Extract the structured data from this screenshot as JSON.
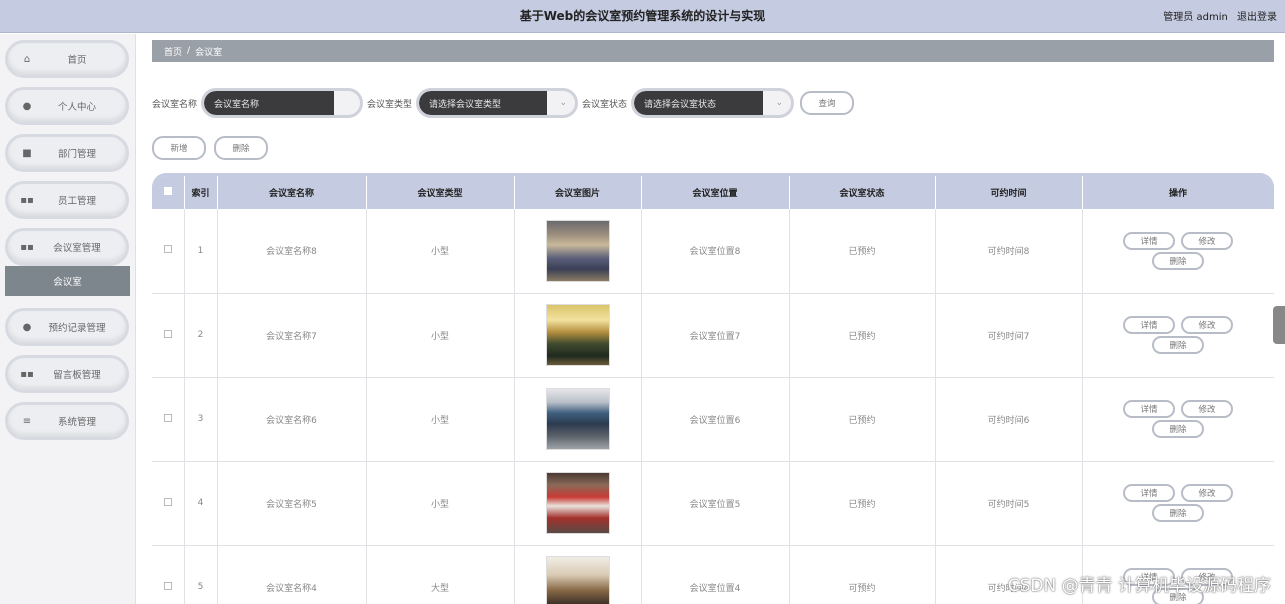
{
  "header": {
    "title": "基于Web的会议室预约管理系统的设计与实现",
    "role": "管理员 admin",
    "logout": "退出登录"
  },
  "sidebar": {
    "items": [
      {
        "label": "首页",
        "icon": "home-icon",
        "glyph": "⌂"
      },
      {
        "label": "个人中心",
        "icon": "user-icon",
        "glyph": "●"
      },
      {
        "label": "部门管理",
        "icon": "department-icon",
        "glyph": "■"
      },
      {
        "label": "员工管理",
        "icon": "grid-icon",
        "glyph": "▪▪"
      },
      {
        "label": "会议室管理",
        "icon": "grid-icon",
        "glyph": "▪▪"
      },
      {
        "label": "预约记录管理",
        "icon": "person-icon",
        "glyph": "●"
      },
      {
        "label": "留言板管理",
        "icon": "grid-icon",
        "glyph": "▪▪"
      },
      {
        "label": "系统管理",
        "icon": "menu-icon",
        "glyph": "≡"
      }
    ],
    "sub_item": "会议室"
  },
  "breadcrumb": {
    "home": "首页",
    "separator": "/",
    "current": "会议室"
  },
  "search": {
    "name_label": "会议室名称",
    "name_placeholder": "会议室名称",
    "type_label": "会议室类型",
    "type_placeholder": "请选择会议室类型",
    "status_label": "会议室状态",
    "status_placeholder": "请选择会议室状态",
    "query_button": "查询"
  },
  "actions": {
    "add": "新增",
    "delete": "删除"
  },
  "table": {
    "headers": [
      "",
      "索引",
      "会议室名称",
      "会议室类型",
      "会议室图片",
      "会议室位置",
      "会议室状态",
      "可约时间",
      "操作"
    ],
    "rows": [
      {
        "index": "1",
        "name": "会议室名称8",
        "type": "小型",
        "location": "会议室位置8",
        "status": "已预约",
        "time": "可约时间8"
      },
      {
        "index": "2",
        "name": "会议室名称7",
        "type": "小型",
        "location": "会议室位置7",
        "status": "已预约",
        "time": "可约时间7"
      },
      {
        "index": "3",
        "name": "会议室名称6",
        "type": "小型",
        "location": "会议室位置6",
        "status": "已预约",
        "time": "可约时间6"
      },
      {
        "index": "4",
        "name": "会议室名称5",
        "type": "小型",
        "location": "会议室位置5",
        "status": "已预约",
        "time": "可约时间5"
      },
      {
        "index": "5",
        "name": "会议室名称4",
        "type": "大型",
        "location": "会议室位置4",
        "status": "可预约",
        "time": "可约时间4"
      }
    ],
    "ops": {
      "detail": "详情",
      "edit": "修改",
      "delete": "删除"
    }
  },
  "watermark": "CSDN @青青 计算机毕设源码程序"
}
